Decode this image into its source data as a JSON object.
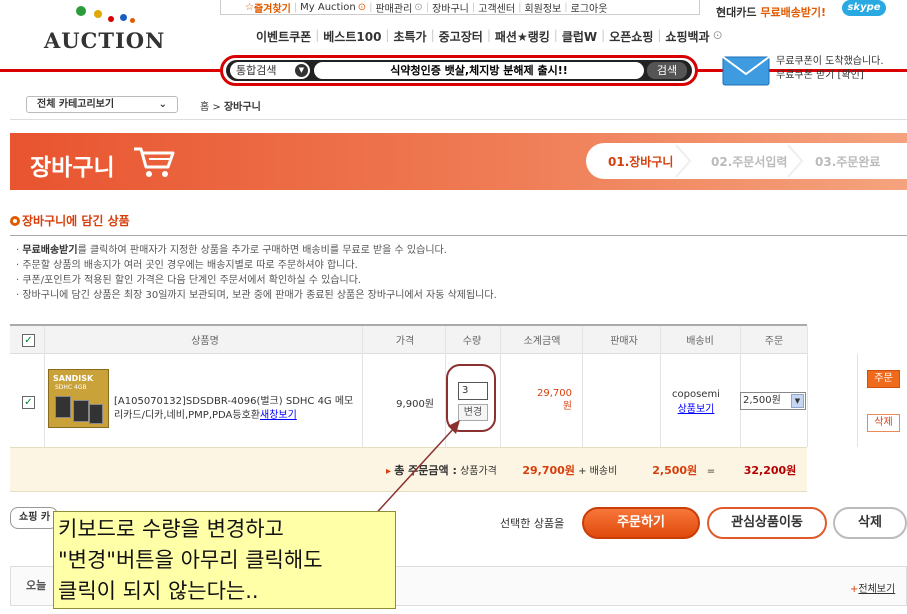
{
  "header": {
    "logo_text": "AUCTION",
    "top_links": [
      "즐겨찾기",
      "My Auction",
      "판매관리",
      "장바구니",
      "고객센터",
      "회원정보",
      "로그아웃"
    ],
    "main_nav": [
      "이벤트쿠폰",
      "베스트100",
      "초특가",
      "중고장터",
      "패션★랭킹",
      "클럽W",
      "오픈쇼핑",
      "쇼핑백과"
    ],
    "promo_brand": "현대카드",
    "promo_text": "무료배송받기!",
    "skype_label": "skype",
    "search": {
      "category": "통합검색",
      "query": "식약청인증 뱃살,체지방 분해제 출시!!",
      "button": "검색"
    },
    "coupon_line1": "무료쿠폰이 도착했습니다.",
    "coupon_line2": "무료쿠폰 받기 [확인]"
  },
  "breadcrumb": {
    "category_select": "전체 카테고리보기",
    "home": "홈",
    "separator": ">",
    "current": "장바구니"
  },
  "banner": {
    "title": "장바구니",
    "steps": [
      "01.장바구니",
      "02.주문서입력",
      "03.주문완료"
    ]
  },
  "section": {
    "title": "장바구니에 담긴 상품",
    "notes": [
      {
        "bold": "무료배송받기",
        "rest": "를 클릭하여 판매자가 지정한 상품을 추가로 구매하면 배송비를 무료로 받을 수 있습니다."
      },
      {
        "bold": "",
        "rest": "주문할 상품의 배송지가 여러 곳인 경우에는 배송지별로 따로 주문하셔야 합니다."
      },
      {
        "bold": "",
        "rest": "쿠폰/포인트가 적용된 할인 가격은 다음 단계인 주문서에서 확인하실 수 있습니다."
      },
      {
        "bold": "",
        "rest": "장바구니에 담긴 상품은 최장 30일까지 보관되며, 보관 중에 판매가 종료된 상품은 장바구니에서 자동 삭제됩니다."
      }
    ]
  },
  "table": {
    "headers": [
      "상품명",
      "가격",
      "수량",
      "소계금액",
      "판매자",
      "배송비",
      "주문"
    ],
    "row": {
      "thumb_brand": "SANDISK",
      "thumb_model": "SDHC 4GB",
      "name": "[A105070132]SDSDBR-4096(벌크) SDHC 4G 메모리카드/디카,네비,PMP,PDA등호환",
      "name_link": "새창보기",
      "price": "9,900원",
      "quantity": "3",
      "quantity_button": "변경",
      "subtotal_num": "29,700",
      "subtotal_unit": "원",
      "seller": "coposemi",
      "seller_link": "상품보기",
      "shipping_fee": "2,500원",
      "order_button": "주문",
      "delete_button": "삭제"
    }
  },
  "totals": {
    "arrow": "▸",
    "label": "총 주문금액 :",
    "goods_label": "상품가격",
    "goods_amount": "29,700원",
    "plus": "+",
    "ship_label": "배송비",
    "ship_amount": "2,500원",
    "equals": "=",
    "total": "32,200원"
  },
  "actions": {
    "shop_button": "쇼핑 카",
    "selected_label": "선택한 상품을",
    "order_button": "주문하기",
    "wish_button": "관심상품이동",
    "delete_button": "삭제"
  },
  "today_section": {
    "label": "오늘",
    "view_all_plus": "+",
    "view_all": "전체보기"
  },
  "callout": {
    "line1": "키보드로 수량을 변경하고",
    "line2": "\"변경\"버튼을 아무리 클릭해도",
    "line3": "클릭이 되지 않는다는.."
  },
  "colors": {
    "brand_red": "#d80000",
    "accent_orange": "#e05a00",
    "banner_start": "#e8542f",
    "callout_bg": "#ffffa8",
    "annotation_line": "#8b3030"
  }
}
